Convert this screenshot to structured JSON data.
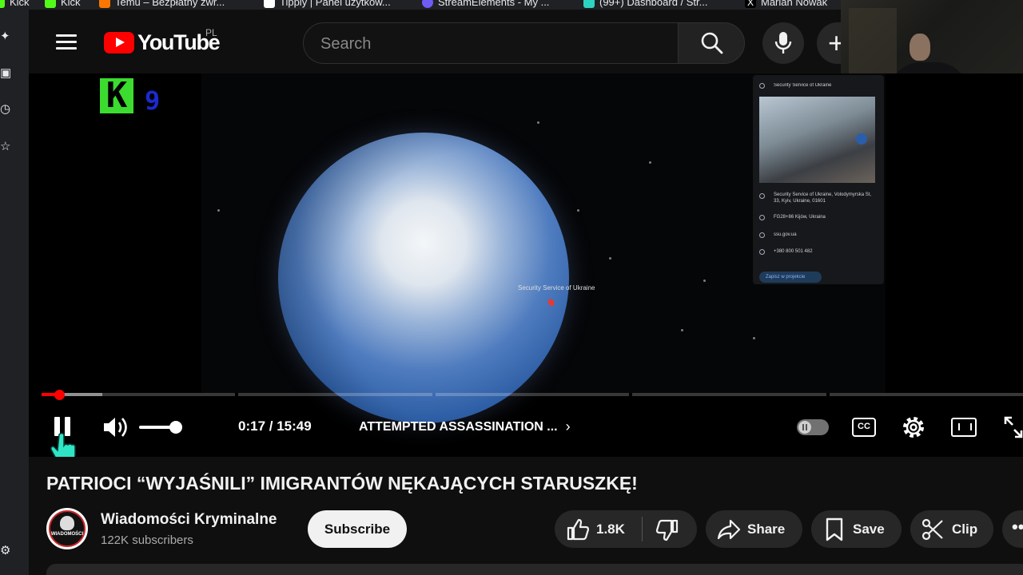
{
  "bookmarks": [
    {
      "label": "Kick",
      "color": "#53fc18"
    },
    {
      "label": "Kick",
      "color": "#53fc18"
    },
    {
      "label": "Temu – Bezpłatny zwr...",
      "color": "#fb7701"
    },
    {
      "label": "Tipply | Panel użytkow...",
      "color": "#ffffff"
    },
    {
      "label": "StreamElements - My ...",
      "color": "#6f5cf5"
    },
    {
      "label": "(99+) Dashboard / Str...",
      "color": "#2dd4bf"
    },
    {
      "label": "Marian Nowak",
      "color": "#ffffff"
    }
  ],
  "header": {
    "logo_text": "YouTube",
    "country_code": "PL",
    "search_placeholder": "Search"
  },
  "video": {
    "watermark_letter": "K",
    "watermark_digit": "9",
    "map_pin_label": "Security Service of Ukraine",
    "info_card": {
      "title": "Security Service of Ukraine",
      "address": "Security Service of Ukraine, Volodymyrska St, 33, Kyiv, Ukraine, 01601",
      "plus_code": "FG28+86 Kijów, Ukraina",
      "website": "ssu.gov.ua",
      "phone": "+380 800 501 482",
      "save_button": "Zapisz w projekcie"
    },
    "progress": {
      "played_fraction": 0.018,
      "buffered_fraction": 0.062
    },
    "chapter_segments": 5,
    "volume_fraction": 0.85,
    "time": "0:17 / 15:49",
    "chapter_title": "ATTEMPTED ASSASSINATION ...",
    "cc_label": "CC",
    "autoplay": false
  },
  "details": {
    "title": "PATRIOCI “WYJAŚNILI” IMIGRANTÓW NĘKAJĄCYCH STARUSZKĘ!",
    "channel_name": "Wiadomości Kryminalne",
    "subscribers": "122K subscribers",
    "avatar_text": "WIADOMOŚCI",
    "subscribe_label": "Subscribe",
    "likes": "1.8K",
    "share_label": "Share",
    "save_label": "Save",
    "clip_label": "Clip"
  },
  "colors": {
    "accent": "#ff0000",
    "background": "#0f0f0f",
    "pill": "#272727",
    "cursor": "#2ee6c5"
  }
}
